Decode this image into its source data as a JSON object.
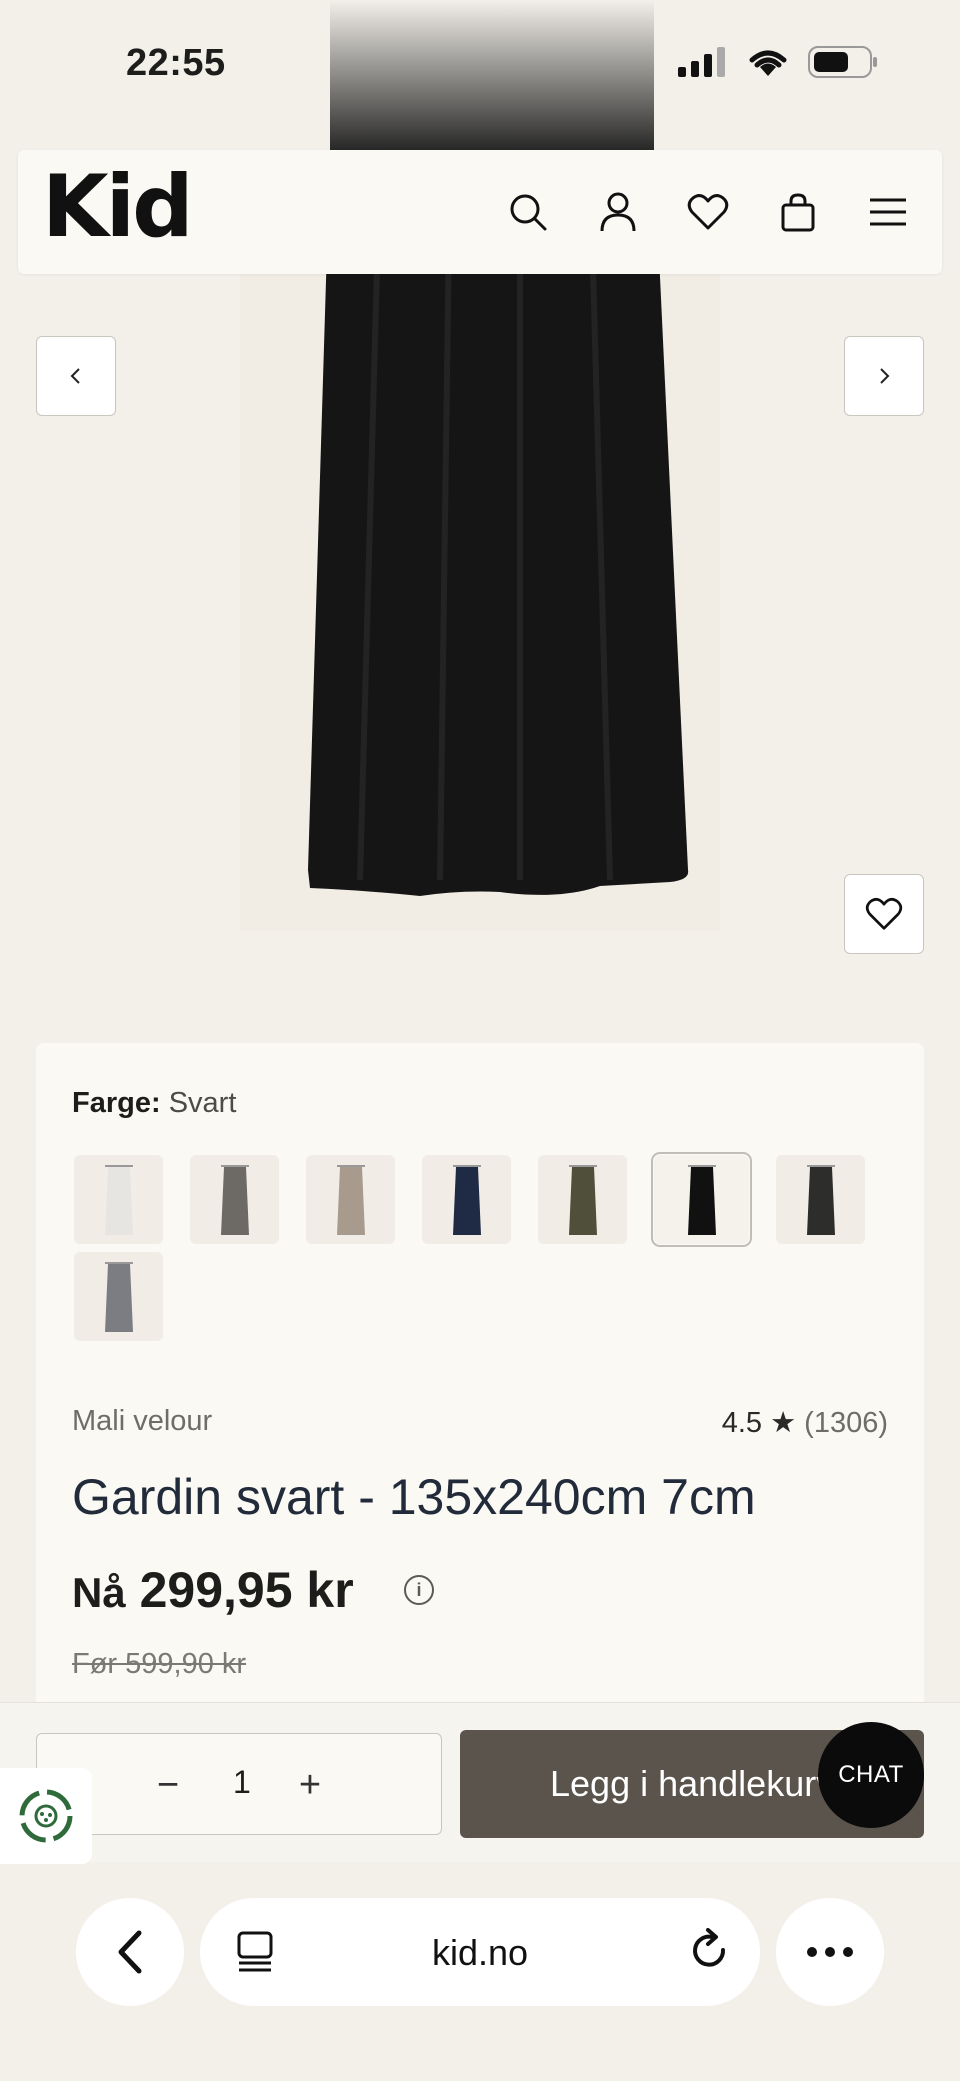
{
  "status_bar": {
    "time": "22:55"
  },
  "header": {
    "logo": "Kid"
  },
  "product": {
    "color_label": "Farge:",
    "color_value": "Svart",
    "swatch_count": 8,
    "selected_swatch": 6,
    "brand": "Mali velour",
    "rating": "4.5",
    "rating_star": "★",
    "review_count": "(1306)",
    "title": "Gardin svart - 135x240cm 7cm",
    "price_prefix": "Nå",
    "price": "299,95 kr",
    "info": "i",
    "old_price": "Før 599,90 kr"
  },
  "cart": {
    "minus": "−",
    "quantity": "1",
    "plus": "+",
    "add_label": "Legg i handlekurv"
  },
  "chat": {
    "label": "CHAT"
  },
  "browser": {
    "domain": "kid.no"
  },
  "swatch_colors": [
    "#e7e5e2",
    "#6d6a66",
    "#a89b8d",
    "#1f2a44",
    "#4f4f3a",
    "#111111",
    "#2d2d2b",
    "#7c7d82"
  ]
}
